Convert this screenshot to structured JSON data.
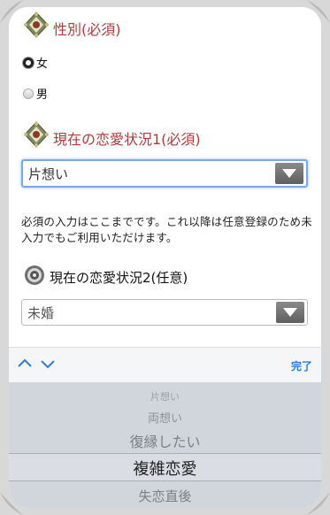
{
  "gender": {
    "label": "性別(必須)",
    "options": [
      {
        "label": "女",
        "selected": true
      },
      {
        "label": "男",
        "selected": false
      }
    ]
  },
  "status1": {
    "label": "現在の恋愛状況1(必須)",
    "value": "片想い"
  },
  "notice": "必須の入力はここまでです。これ以降は任意登録のため未入力でもご利用いただけます。",
  "status2": {
    "label": "現在の恋愛状況2(任意)",
    "value": "未婚"
  },
  "toolbar": {
    "done_label": "完了"
  },
  "picker": {
    "items": [
      "片想い",
      "両想い",
      "復縁したい",
      "複雑恋愛",
      "失恋直後"
    ],
    "selected": "複雑恋愛"
  },
  "colors": {
    "section_title": "#b23a3a",
    "done_link": "#2a7de1",
    "focus_border": "#79a9e6"
  }
}
